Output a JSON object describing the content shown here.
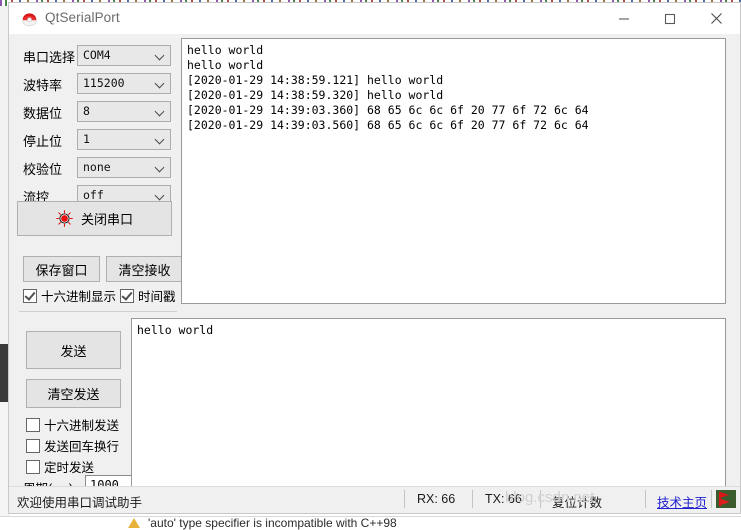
{
  "window": {
    "title": "QtSerialPort",
    "icon": "qt-logo-icon",
    "minimize": "─",
    "maximize": "☐",
    "close": "✕"
  },
  "settings": {
    "rows": [
      {
        "label": "串口选择",
        "value": "COM4",
        "name": "port-select"
      },
      {
        "label": "波特率",
        "value": "115200",
        "name": "baudrate-select"
      },
      {
        "label": "数据位",
        "value": "8",
        "name": "databits-select"
      },
      {
        "label": "停止位",
        "value": "1",
        "name": "stopbits-select"
      },
      {
        "label": "校验位",
        "value": "none",
        "name": "parity-select"
      },
      {
        "label": "流控",
        "value": "off",
        "name": "flowcontrol-select"
      }
    ]
  },
  "buttons": {
    "close_port": "关闭串口",
    "save_window": "保存窗口",
    "clear_receive": "清空接收",
    "send": "发送",
    "clear_send": "清空发送"
  },
  "receive_options": [
    {
      "label": "十六进制显示",
      "checked": true,
      "name": "hex-display-checkbox"
    },
    {
      "label": "时间戳",
      "checked": true,
      "name": "timestamp-checkbox"
    }
  ],
  "send_options": [
    {
      "label": "十六进制发送",
      "checked": false,
      "name": "hex-send-checkbox"
    },
    {
      "label": "发送回车换行",
      "checked": false,
      "name": "send-crlf-checkbox"
    },
    {
      "label": "定时发送",
      "checked": false,
      "name": "timed-send-checkbox"
    }
  ],
  "period": {
    "label": "周期(ms)",
    "value": "1000"
  },
  "receive_text": "hello world\nhello world\n[2020-01-29 14:38:59.121] hello world\n[2020-01-29 14:38:59.320] hello world\n[2020-01-29 14:39:03.360] 68 65 6c 6c 6f 20 77 6f 72 6c 64\n[2020-01-29 14:39:03.560] 68 65 6c 6c 6f 20 77 6f 72 6c 64",
  "send_text": "hello world",
  "statusbar": {
    "message": "欢迎使用串口调试助手",
    "rx": "RX: 66",
    "tx": "TX: 66",
    "reset_counter": "复位计数",
    "homepage_link": "技术主页",
    "tray_icon": "flag-icon"
  },
  "watermark": "blog.csdn.net",
  "background": {
    "warning_text": "'auto' type specifier is incompatible with C++98",
    "warning_icon": "warning-triangle-icon"
  },
  "colors": {
    "led_red": "#e81010",
    "link_blue": "#2020d0",
    "window_bg": "#f0f0f0",
    "field_bg": "#e8e8e8"
  }
}
